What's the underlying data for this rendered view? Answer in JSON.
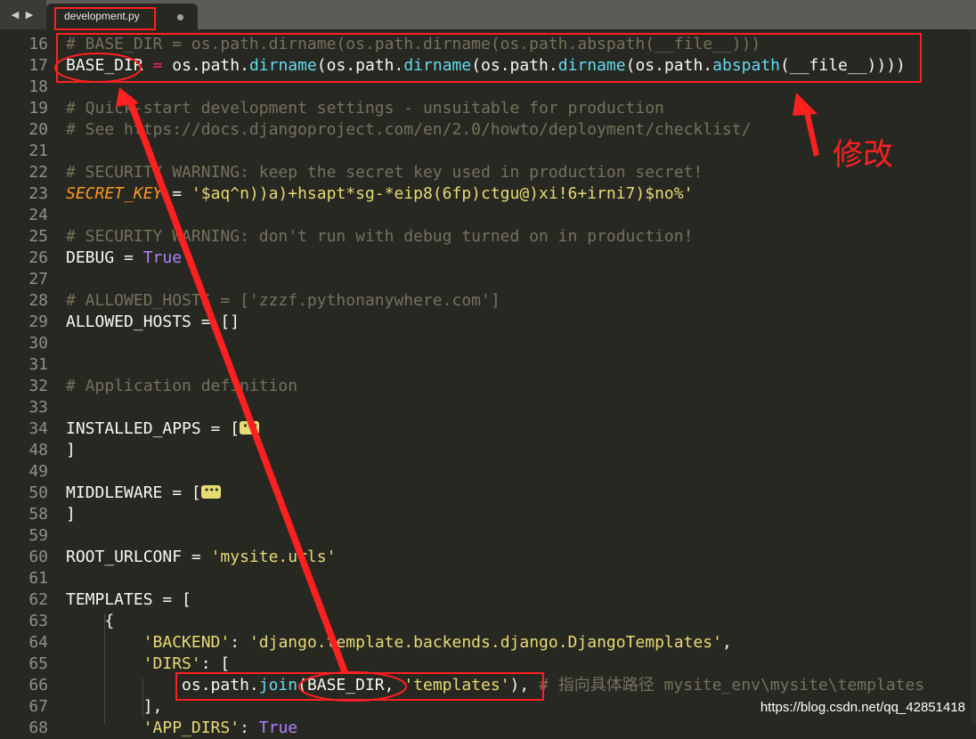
{
  "tab": {
    "nav_arrows": "◀ ▶",
    "filename": "development.py"
  },
  "lines": [
    {
      "n": "16",
      "segs": [
        {
          "t": "# BASE_DIR = os.path.dirname(os.path.dirname(os.path.abspath(__file__)))",
          "c": "comment"
        }
      ]
    },
    {
      "n": "17",
      "segs": [
        {
          "t": "BASE_DIR ",
          "c": "plain"
        },
        {
          "t": "=",
          "c": "operator"
        },
        {
          "t": " os.path.",
          "c": "plain"
        },
        {
          "t": "dirname",
          "c": "builtin"
        },
        {
          "t": "(os.path.",
          "c": "plain"
        },
        {
          "t": "dirname",
          "c": "builtin"
        },
        {
          "t": "(os.path.",
          "c": "plain"
        },
        {
          "t": "dirname",
          "c": "builtin"
        },
        {
          "t": "(os.path.",
          "c": "plain"
        },
        {
          "t": "abspath",
          "c": "builtin"
        },
        {
          "t": "(__file__))))",
          "c": "plain"
        }
      ]
    },
    {
      "n": "18",
      "segs": []
    },
    {
      "n": "19",
      "segs": [
        {
          "t": "# Quick-start development settings - unsuitable for production",
          "c": "comment"
        }
      ]
    },
    {
      "n": "20",
      "segs": [
        {
          "t": "# See https://docs.djangoproject.com/en/2.0/howto/deployment/checklist/",
          "c": "comment"
        }
      ]
    },
    {
      "n": "21",
      "segs": []
    },
    {
      "n": "22",
      "segs": [
        {
          "t": "# SECURITY WARNING: keep the secret key used in production secret!",
          "c": "comment"
        }
      ]
    },
    {
      "n": "23",
      "segs": [
        {
          "t": "SECRET_KEY",
          "c": "italic-var"
        },
        {
          "t": " = ",
          "c": "plain"
        },
        {
          "t": "'$aq^n))a)+hsapt*sg-*eip8(6fp)ctgu@)xi!6+irni7)$no%'",
          "c": "string"
        }
      ]
    },
    {
      "n": "24",
      "segs": []
    },
    {
      "n": "25",
      "segs": [
        {
          "t": "# SECURITY WARNING: don't run with debug turned on in production!",
          "c": "comment"
        }
      ]
    },
    {
      "n": "26",
      "segs": [
        {
          "t": "DEBUG = ",
          "c": "plain"
        },
        {
          "t": "True",
          "c": "constant"
        }
      ]
    },
    {
      "n": "27",
      "segs": []
    },
    {
      "n": "28",
      "segs": [
        {
          "t": "# ALLOWED_HOSTS = ['zzzf.pythonanywhere.com']",
          "c": "comment"
        }
      ]
    },
    {
      "n": "29",
      "segs": [
        {
          "t": "ALLOWED_HOSTS = []",
          "c": "plain"
        }
      ]
    },
    {
      "n": "30",
      "segs": []
    },
    {
      "n": "31",
      "segs": []
    },
    {
      "n": "32",
      "segs": [
        {
          "t": "# Application definition",
          "c": "comment"
        }
      ]
    },
    {
      "n": "33",
      "segs": []
    },
    {
      "n": "34",
      "segs": [
        {
          "t": "INSTALLED_APPS = [",
          "c": "plain"
        },
        {
          "t": "",
          "c": "fold"
        }
      ]
    },
    {
      "n": "48",
      "segs": [
        {
          "t": "]",
          "c": "plain"
        }
      ]
    },
    {
      "n": "49",
      "segs": []
    },
    {
      "n": "50",
      "segs": [
        {
          "t": "MIDDLEWARE = [",
          "c": "plain"
        },
        {
          "t": "",
          "c": "fold"
        }
      ]
    },
    {
      "n": "58",
      "segs": [
        {
          "t": "]",
          "c": "plain"
        }
      ]
    },
    {
      "n": "59",
      "segs": []
    },
    {
      "n": "60",
      "segs": [
        {
          "t": "ROOT_URLCONF = ",
          "c": "plain"
        },
        {
          "t": "'mysite.urls'",
          "c": "string"
        }
      ]
    },
    {
      "n": "61",
      "segs": []
    },
    {
      "n": "62",
      "segs": [
        {
          "t": "TEMPLATES = [",
          "c": "plain"
        }
      ]
    },
    {
      "n": "63",
      "segs": [
        {
          "t": "    {",
          "c": "plain"
        }
      ]
    },
    {
      "n": "64",
      "segs": [
        {
          "t": "        ",
          "c": "plain"
        },
        {
          "t": "'BACKEND'",
          "c": "string"
        },
        {
          "t": ": ",
          "c": "plain"
        },
        {
          "t": "'django.template.backends.django.DjangoTemplates'",
          "c": "string"
        },
        {
          "t": ",",
          "c": "plain"
        }
      ]
    },
    {
      "n": "65",
      "segs": [
        {
          "t": "        ",
          "c": "plain"
        },
        {
          "t": "'DIRS'",
          "c": "string"
        },
        {
          "t": ": [",
          "c": "plain"
        }
      ]
    },
    {
      "n": "66",
      "segs": [
        {
          "t": "            os.path.",
          "c": "plain"
        },
        {
          "t": "join",
          "c": "builtin"
        },
        {
          "t": "(BASE_DIR, ",
          "c": "plain"
        },
        {
          "t": "'templates'",
          "c": "string"
        },
        {
          "t": "), ",
          "c": "plain"
        },
        {
          "t": "# 指向具体路径 mysite_env\\mysite\\templates",
          "c": "comment"
        }
      ]
    },
    {
      "n": "67",
      "segs": [
        {
          "t": "        ],",
          "c": "plain"
        }
      ]
    },
    {
      "n": "68",
      "segs": [
        {
          "t": "        ",
          "c": "plain"
        },
        {
          "t": "'APP_DIRS'",
          "c": "string"
        },
        {
          "t": ": ",
          "c": "plain"
        },
        {
          "t": "True",
          "c": "constant"
        }
      ]
    }
  ],
  "annotation": {
    "label": "修改",
    "color": "#ff2020"
  },
  "watermark": "https://blog.csdn.net/qq_42851418",
  "colors": {
    "background": "#272822",
    "comment": "#75715e",
    "string": "#e6db74",
    "builtin": "#66d9ef",
    "constant": "#ae81ff",
    "operator": "#f92672",
    "annotation": "#ff2020"
  }
}
